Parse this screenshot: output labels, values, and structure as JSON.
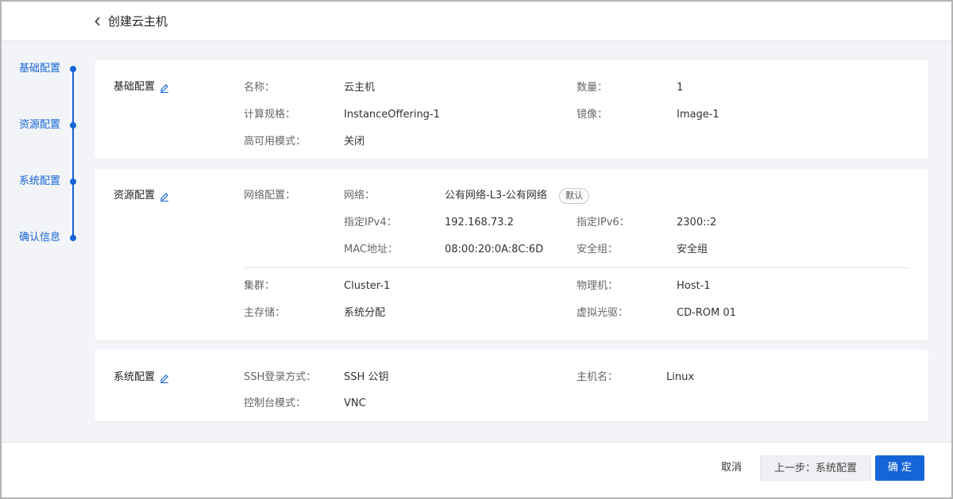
{
  "header": {
    "title": "创建云主机",
    "back_icon": "chevron-left-icon"
  },
  "steps": [
    {
      "label": "基础配置"
    },
    {
      "label": "资源配置"
    },
    {
      "label": "系统配置"
    },
    {
      "label": "确认信息"
    }
  ],
  "colors": {
    "accent": "#1665d8",
    "background": "#f2f4f7"
  },
  "basic": {
    "title": "基础配置",
    "name_label": "名称：",
    "name_value": "云主机",
    "count_label": "数量：",
    "count_value": "1",
    "offering_label": "计算规格：",
    "offering_value": "InstanceOffering-1",
    "image_label": "镜像：",
    "image_value": "Image-1",
    "ha_label": "高可用模式：",
    "ha_value": "关闭"
  },
  "resource": {
    "title": "资源配置",
    "network_config_label": "网络配置：",
    "network_label": "网络：",
    "network_value": "公有网络-L3-公有网络",
    "network_badge": "默认",
    "ipv4_label": "指定IPv4：",
    "ipv4_value": "192.168.73.2",
    "ipv6_label": "指定IPv6：",
    "ipv6_value": "2300::2",
    "mac_label": "MAC地址：",
    "mac_value": "08:00:20:0A:8C:6D",
    "secgroup_label": "安全组：",
    "secgroup_value": "安全组",
    "cluster_label": "集群：",
    "cluster_value": "Cluster-1",
    "host_label": "物理机：",
    "host_value": "Host-1",
    "storage_label": "主存储：",
    "storage_value": "系统分配",
    "cdrom_label": "虚拟光驱：",
    "cdrom_value": "CD-ROM 01"
  },
  "system": {
    "title": "系统配置",
    "ssh_label": "SSH登录方式：",
    "ssh_value": "SSH 公钥",
    "hostname_label": "主机名：",
    "hostname_value": "Linux",
    "console_label": "控制台模式：",
    "console_value": "VNC"
  },
  "footer": {
    "cancel_label": "取消",
    "prev_label": "上一步：系统配置",
    "ok_label": "确 定"
  }
}
